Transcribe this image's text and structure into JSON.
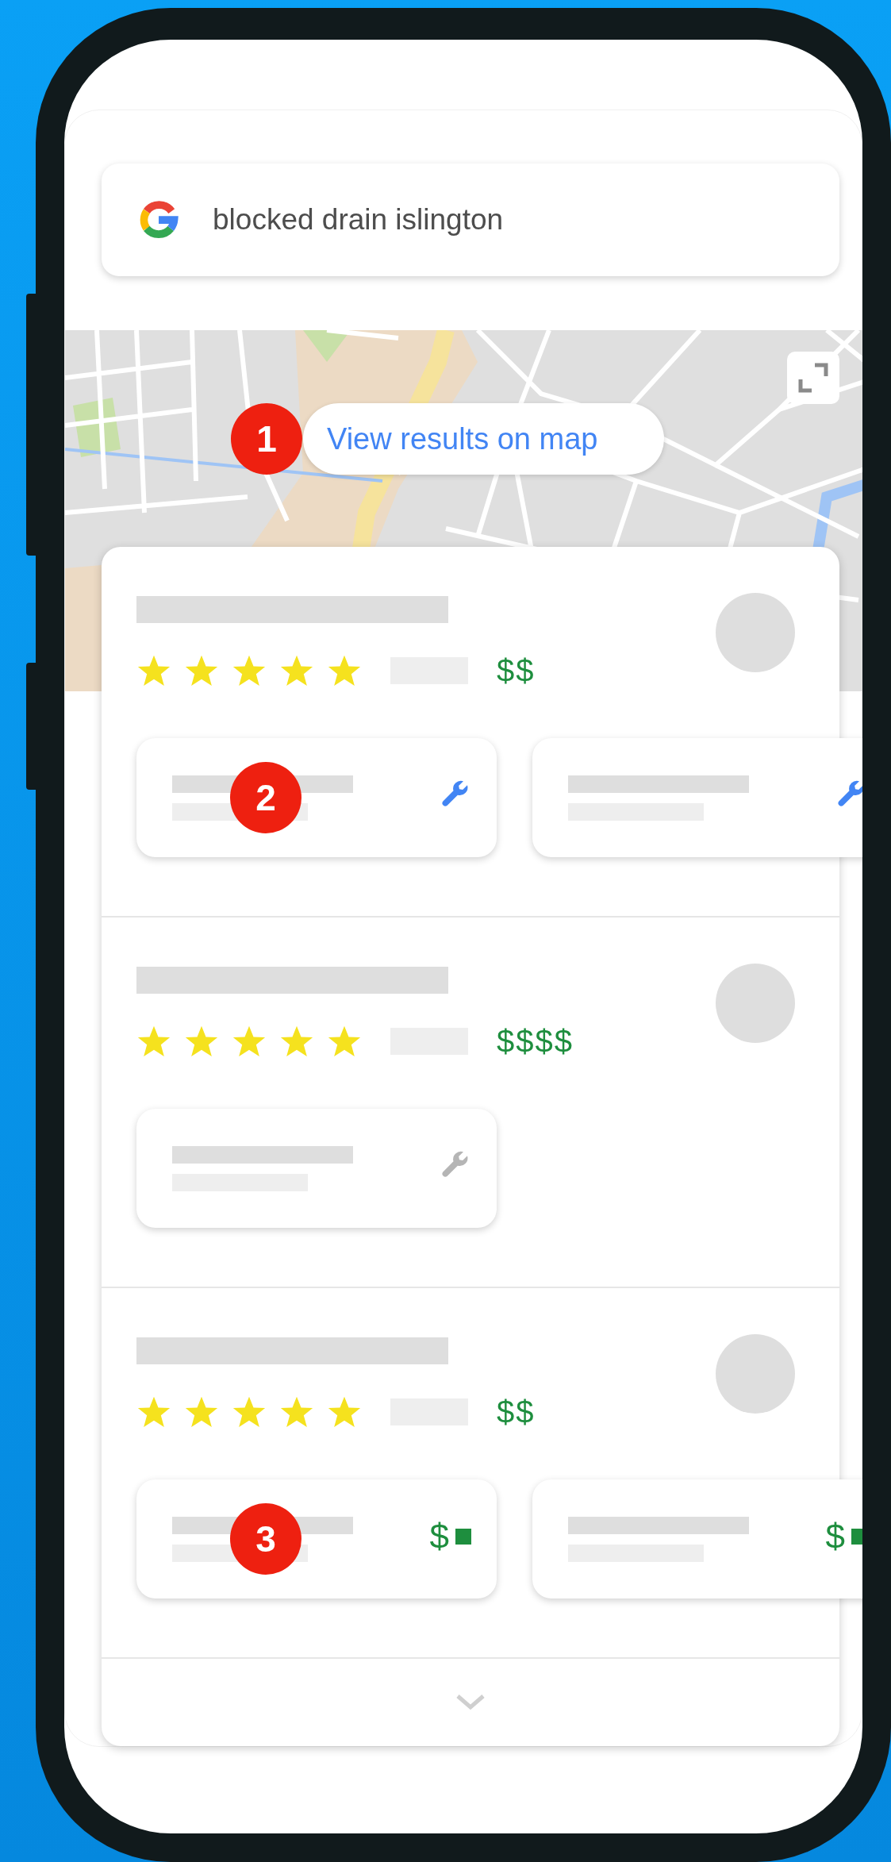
{
  "search": {
    "query": "blocked drain islington"
  },
  "map": {
    "button_label": "View results on map",
    "badge": "1"
  },
  "results": [
    {
      "stars": 5,
      "price": "$$",
      "chips": [
        {
          "kind": "service",
          "highlighted": true,
          "badge": "2"
        },
        {
          "kind": "service",
          "highlighted": true
        }
      ]
    },
    {
      "stars": 5,
      "price": "$$$$",
      "chips": [
        {
          "kind": "service",
          "highlighted": false
        }
      ]
    },
    {
      "stars": 5,
      "price": "$$",
      "chips": [
        {
          "kind": "price",
          "symbol": "$",
          "badge": "3"
        },
        {
          "kind": "price",
          "symbol": "$"
        }
      ]
    }
  ]
}
